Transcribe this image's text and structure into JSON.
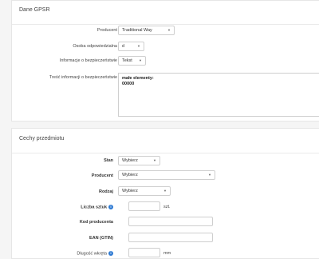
{
  "gpsr": {
    "title": "Dane GPSR",
    "producent_label": "Producent",
    "producent_value": "Traditional Way",
    "osoba_label": "Osoba odpowiedzialna",
    "osoba_value": "d",
    "info_label": "Informacje o bezpieczeństwie",
    "info_value": "Tekst",
    "tresc_label": "Treść informacji o bezpieczeństwie",
    "tresc_line1": "małe elementy:",
    "tresc_line2": "00000"
  },
  "cechy": {
    "title": "Cechy przedmiotu",
    "stan_label": "Stan",
    "stan_value": "Wybierz",
    "producent_label": "Producent",
    "producent_value": "Wybierz",
    "rodzaj_label": "Rodzaj",
    "rodzaj_value": "Wybierz",
    "liczba_label": "Liczba sztuk",
    "liczba_unit": "szt.",
    "kod_label": "Kod producenta",
    "ean_label": "EAN (GTIN)",
    "dlugosc_label": "Długość wkręta",
    "dlugosc_unit": "mm"
  },
  "icons": {
    "info": "i",
    "caret": "▼"
  }
}
